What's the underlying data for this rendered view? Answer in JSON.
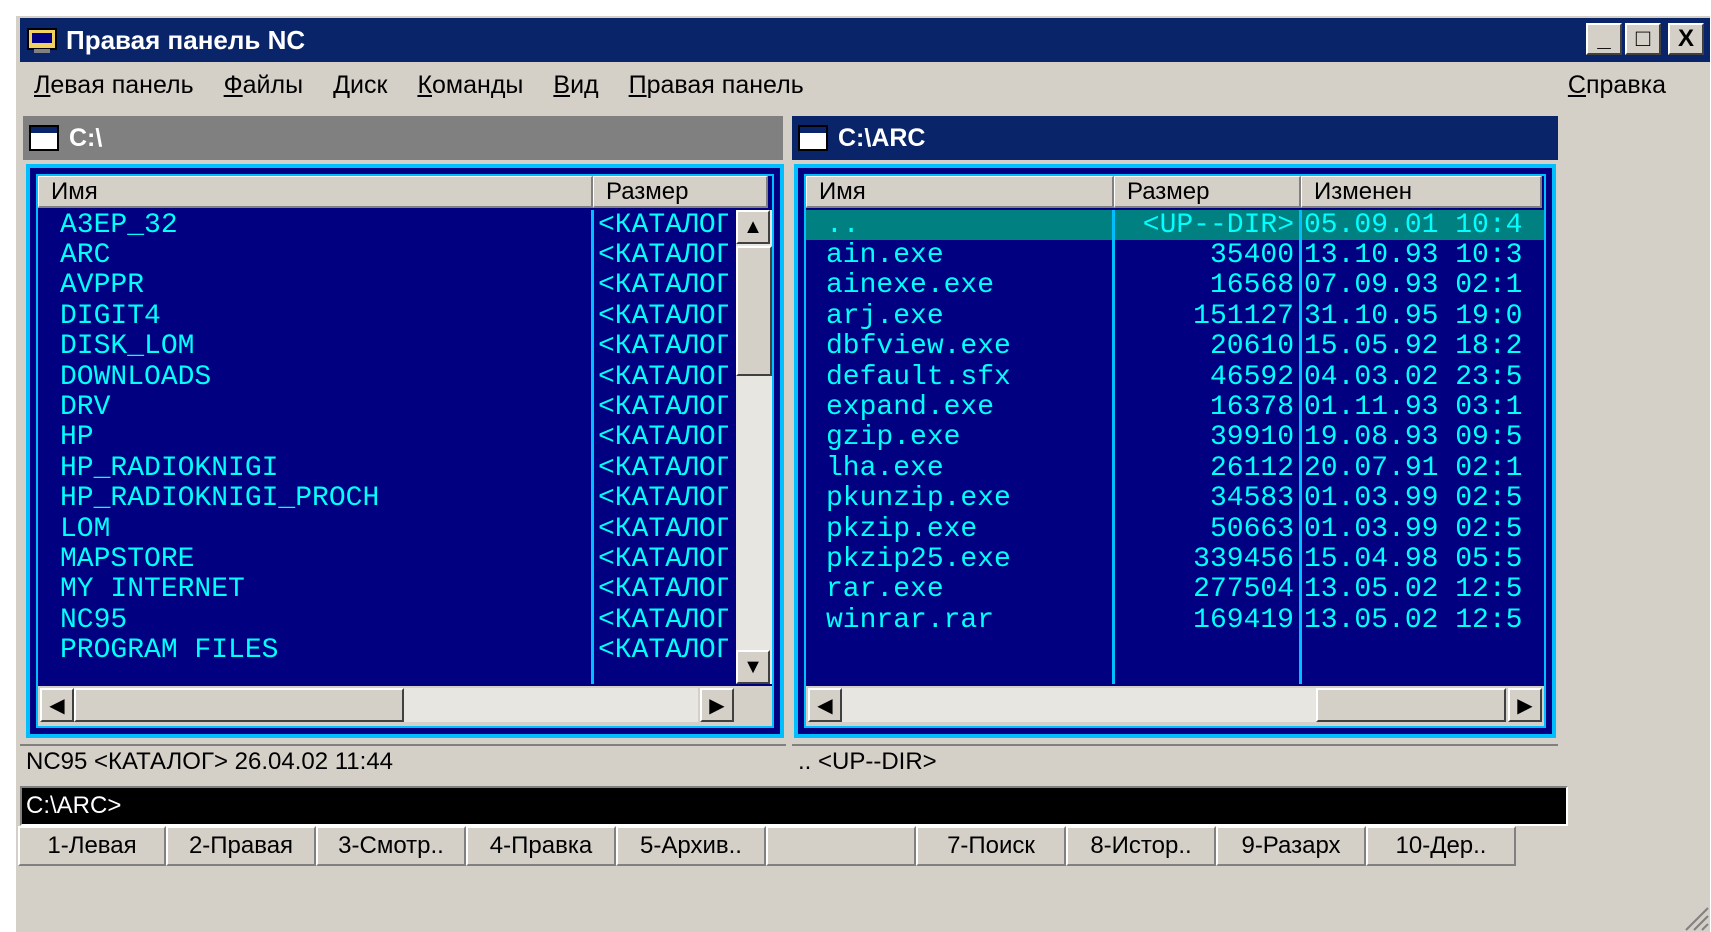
{
  "window": {
    "title": "Правая панель NC",
    "title_buttons": [
      "_",
      "□",
      "X"
    ]
  },
  "menu": {
    "items": [
      "Левая панель",
      "Файлы",
      "Диск",
      "Команды",
      "Вид",
      "Правая панель"
    ],
    "help": "Справка"
  },
  "left_panel": {
    "path": "C:\\",
    "columns": [
      "Имя",
      "Размер"
    ],
    "rows": [
      {
        "name": "A3EP_32",
        "size": "<КАТАЛОГ>"
      },
      {
        "name": "ARC",
        "size": "<КАТАЛОГ>"
      },
      {
        "name": "AVPPR",
        "size": "<КАТАЛОГ>"
      },
      {
        "name": "DIGIT4",
        "size": "<КАТАЛОГ>"
      },
      {
        "name": "DISK_LOM",
        "size": "<КАТАЛОГ>"
      },
      {
        "name": "DOWNLOADS",
        "size": "<КАТАЛОГ>"
      },
      {
        "name": "DRV",
        "size": "<КАТАЛОГ>"
      },
      {
        "name": "HP",
        "size": "<КАТАЛОГ>"
      },
      {
        "name": "HP_RADIOKNIGI",
        "size": "<КАТАЛОГ>"
      },
      {
        "name": "HP_RADIOKNIGI_PROCH",
        "size": "<КАТАЛОГ>"
      },
      {
        "name": "LOM",
        "size": "<КАТАЛОГ>"
      },
      {
        "name": "MAPSTORE",
        "size": "<КАТАЛОГ>"
      },
      {
        "name": "MY INTERNET",
        "size": "<КАТАЛОГ>"
      },
      {
        "name": "NC95",
        "size": "<КАТАЛОГ>"
      },
      {
        "name": "PROGRAM FILES",
        "size": "<КАТАЛОГ>"
      }
    ],
    "status": "NC95  <КАТАЛОГ>  26.04.02 11:44"
  },
  "right_panel": {
    "path": "C:\\ARC",
    "columns": [
      "Имя",
      "Размер",
      "Изменен"
    ],
    "rows": [
      {
        "name": "..",
        "size": "<UP--DIR>",
        "date": "05.09.01 10:4"
      },
      {
        "name": "ain.exe",
        "size": "35400",
        "date": "13.10.93 10:3"
      },
      {
        "name": "ainexe.exe",
        "size": "16568",
        "date": "07.09.93 02:1"
      },
      {
        "name": "arj.exe",
        "size": "151127",
        "date": "31.10.95 19:0"
      },
      {
        "name": "dbfview.exe",
        "size": "20610",
        "date": "15.05.92 18:2"
      },
      {
        "name": "default.sfx",
        "size": "46592",
        "date": "04.03.02 23:5"
      },
      {
        "name": "expand.exe",
        "size": "16378",
        "date": "01.11.93 03:1"
      },
      {
        "name": "gzip.exe",
        "size": "39910",
        "date": "19.08.93 09:5"
      },
      {
        "name": "lha.exe",
        "size": "26112",
        "date": "20.07.91 02:1"
      },
      {
        "name": "pkunzip.exe",
        "size": "34583",
        "date": "01.03.99 02:5"
      },
      {
        "name": "pkzip.exe",
        "size": "50663",
        "date": "01.03.99 02:5"
      },
      {
        "name": "pkzip25.exe",
        "size": "339456",
        "date": "15.04.98 05:5"
      },
      {
        "name": "rar.exe",
        "size": "277504",
        "date": "13.05.02 12:5"
      },
      {
        "name": "winrar.rar",
        "size": "169419",
        "date": "13.05.02 12:5"
      }
    ],
    "status": "..  <UP--DIR>"
  },
  "command_line": "C:\\ARC>",
  "fkeys": [
    "1-Левая",
    "2-Правая",
    "3-Смотр..",
    "4-Правка",
    "5-Архив..",
    "",
    "7-Поиск",
    "8-Истор..",
    "9-Разарх",
    "10-Дер.."
  ],
  "colors": {
    "panel_bg": "#000080",
    "panel_text": "#00ffff",
    "title_bg": "#0a246a",
    "selection": "#008080"
  }
}
